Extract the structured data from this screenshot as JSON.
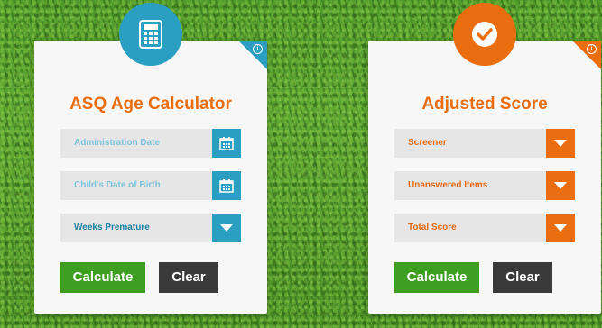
{
  "colors": {
    "blue": "#2b9fc2",
    "orange": "#ea6d10",
    "green": "#3e9e21",
    "dark": "#3a3a3a"
  },
  "age_card": {
    "icon": "calculator-icon",
    "title": "ASQ Age Calculator",
    "fields": [
      {
        "label": "Administration Date",
        "icon": "calendar-icon"
      },
      {
        "label": "Child's Date of Birth",
        "icon": "calendar-icon"
      },
      {
        "label": "Weeks Premature",
        "icon": "chevron-down-icon"
      }
    ],
    "calculate_label": "Calculate",
    "clear_label": "Clear",
    "info_label": "i"
  },
  "score_card": {
    "icon": "checkmark-icon",
    "title": "Adjusted Score",
    "fields": [
      {
        "label": "Screener",
        "icon": "chevron-down-icon"
      },
      {
        "label": "Unanswered Items",
        "icon": "chevron-down-icon"
      },
      {
        "label": "Total Score",
        "icon": "chevron-down-icon"
      }
    ],
    "calculate_label": "Calculate",
    "clear_label": "Clear",
    "info_label": "i"
  }
}
